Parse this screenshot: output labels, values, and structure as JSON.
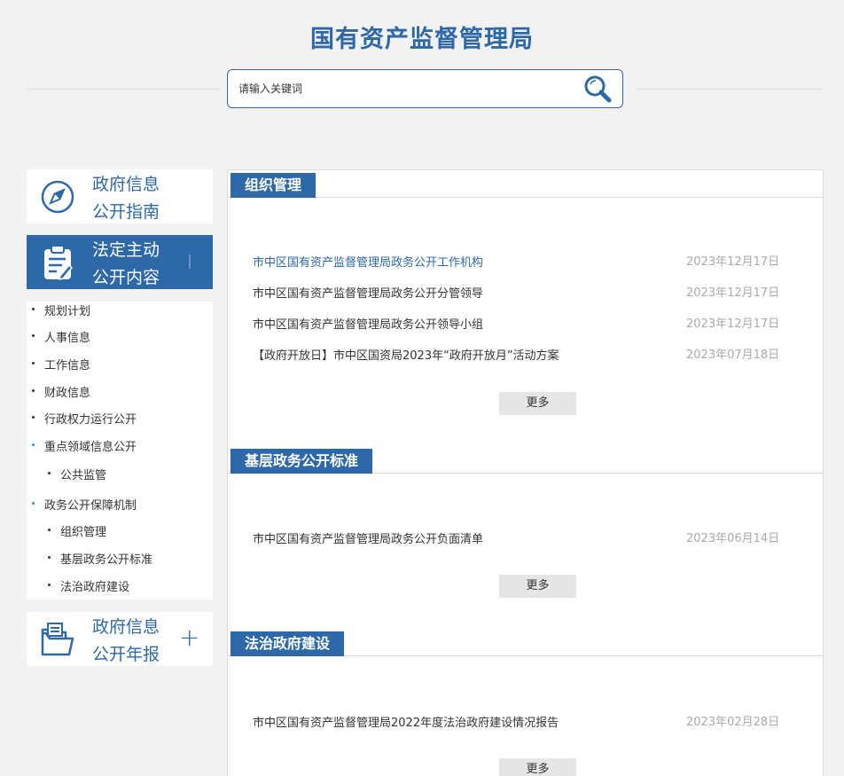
{
  "header": {
    "title": "国有资产监督管理局",
    "search_placeholder": "请输入关键词"
  },
  "sidebar": {
    "guide_card": {
      "line1": "政府信息",
      "line2": "公开指南",
      "icon": "compass-icon"
    },
    "active_card": {
      "line1": "法定主动",
      "line2": "公开内容",
      "icon": "clipboard-icon"
    },
    "report_card": {
      "line1": "政府信息",
      "line2": "公开年报",
      "icon": "folder-icon",
      "expand": "+"
    },
    "items": [
      "规划计划",
      "人事信息",
      "工作信息",
      "财政信息",
      "行政权力运行公开",
      "重点领域信息公开",
      "公共监管",
      "政务公开保障机制",
      "组织管理",
      "基层政务公开标准",
      "法治政府建设"
    ]
  },
  "sections": [
    {
      "title": "组织管理",
      "items": [
        {
          "title": "市中区国有资产监督管理局政务公开工作机构",
          "date": "2023年12月17日"
        },
        {
          "title": "市中区国有资产监督管理局政务公开分管领导",
          "date": "2023年12月17日"
        },
        {
          "title": "市中区国有资产监督管理局政务公开领导小组",
          "date": "2023年12月17日"
        },
        {
          "title": "【政府开放日】市中区国资局2023年“政府开放月”活动方案",
          "date": "2023年07月18日"
        }
      ],
      "more": "更多"
    },
    {
      "title": "基层政务公开标准",
      "items": [
        {
          "title": "市中区国有资产监督管理局政务公开负面清单",
          "date": "2023年06月14日"
        }
      ],
      "more": "更多"
    },
    {
      "title": "法治政府建设",
      "items": [
        {
          "title": "市中区国有资产监督管理局2022年度法治政府建设情况报告",
          "date": "2023年02月28日"
        }
      ],
      "more": "更多"
    }
  ],
  "colors": {
    "brand": "#2d68a8",
    "background": "#f2f2f2",
    "date": "#aaaaaa"
  }
}
